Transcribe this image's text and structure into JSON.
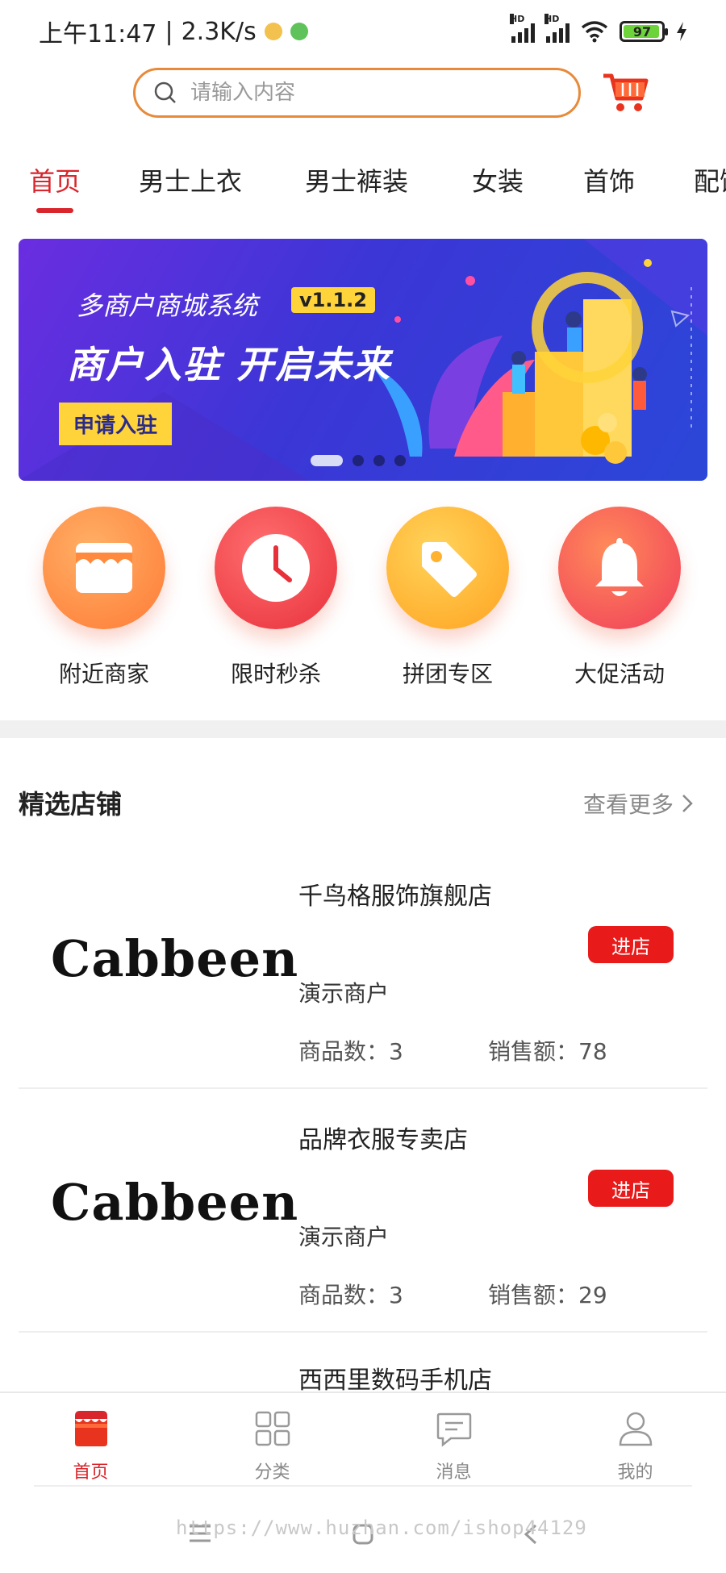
{
  "status_bar": {
    "time": "上午11:47",
    "speed": "2.3K/s",
    "battery": "97",
    "hd1": "HD",
    "hd2": "HD"
  },
  "search": {
    "placeholder": "请输入内容"
  },
  "tabs": [
    {
      "label": "首页",
      "active": true
    },
    {
      "label": "男士上衣"
    },
    {
      "label": "男士裤装"
    },
    {
      "label": "女装"
    },
    {
      "label": "首饰"
    },
    {
      "label": "配饰"
    }
  ],
  "banner": {
    "subtitle": "多商户商城系统",
    "version": "v1.1.2",
    "title": "商户入驻  开启未来",
    "cta": "申请入驻",
    "slide_count": 4,
    "active_slide": 1
  },
  "categories": [
    {
      "label": "附近商家",
      "icon": "store-icon",
      "color": "#ff8a3d"
    },
    {
      "label": "限时秒杀",
      "icon": "clock-icon",
      "color": "#f0474f"
    },
    {
      "label": "拼团专区",
      "icon": "tag-icon",
      "color": "#ffb22e"
    },
    {
      "label": "大促活动",
      "icon": "bell-icon",
      "color": "#ff5a4a"
    }
  ],
  "section": {
    "title": "精选店铺",
    "more": "查看更多"
  },
  "stores": [
    {
      "logo": "Cabbeen",
      "name": "千鸟格服饰旗舰店",
      "tag": "演示商户",
      "goods": "商品数：3",
      "sales": "销售额：78",
      "enter": "进店"
    },
    {
      "logo": "Cabbeen",
      "name": "品牌衣服专卖店",
      "tag": "演示商户",
      "goods": "商品数：3",
      "sales": "销售额：29",
      "enter": "进店"
    },
    {
      "name": "西西里数码手机店"
    }
  ],
  "bottom_nav": [
    {
      "label": "首页",
      "icon": "home-store-icon",
      "active": true
    },
    {
      "label": "分类",
      "icon": "grid-icon"
    },
    {
      "label": "消息",
      "icon": "message-icon"
    },
    {
      "label": "我的",
      "icon": "user-icon"
    }
  ],
  "watermark": "https://www.huzhan.com/ishop44129",
  "colors": {
    "accent": "#d9262c",
    "enter_button": "#e81a1a",
    "search_border": "#e88a3a"
  }
}
